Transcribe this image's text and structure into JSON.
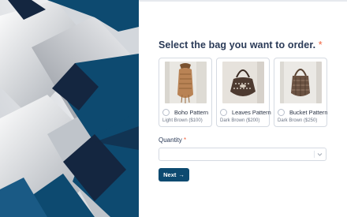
{
  "form": {
    "question": "Select the bag you want to order.",
    "required_mark": "*",
    "options": [
      {
        "label": "Boho Pattern",
        "sub": "Light Brown ($100)",
        "selected": false
      },
      {
        "label": "Leaves Pattern",
        "sub": "Dark Brown ($200)",
        "selected": false
      },
      {
        "label": "Bucket Pattern",
        "sub": "Dark Brown ($250)",
        "selected": false
      }
    ],
    "quantity_label": "Quantity",
    "quantity_required_mark": "*",
    "quantity_value": "",
    "next_label": "Next",
    "next_arrow": "→"
  },
  "icons": {
    "dropdown": "chevron-down-icon",
    "next": "arrow-right-icon"
  },
  "colors": {
    "accent": "#0d4a70",
    "required": "#f0633e",
    "heading": "#2a3a57",
    "navy_dark": "#142640"
  }
}
